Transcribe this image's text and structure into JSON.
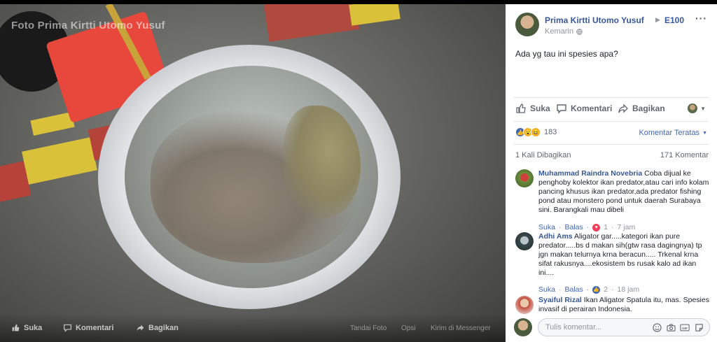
{
  "photo": {
    "watermark": "Foto Prima Kirtti Utomo Yusuf",
    "actions": {
      "like": "Suka",
      "comment": "Komentari",
      "share": "Bagikan",
      "tag_photo": "Tandai Foto",
      "options": "Opsi",
      "send_messenger": "Kirim di Messenger"
    }
  },
  "post": {
    "author": "Prima Kirtti Utomo Yusuf",
    "target": "E100",
    "time": "Kemarin",
    "text": "Ada yg tau ini spesies apa?",
    "actions": {
      "like": "Suka",
      "comment": "Komentari",
      "share": "Bagikan"
    },
    "reaction_count": "183",
    "sort_label": "Komentar Teratas",
    "share_count": "1 Kali Dibagikan",
    "comment_count": "171 Komentar"
  },
  "comments": [
    {
      "name": "Muhammad Raindra Novebria",
      "text": "Coba dijual ke penghoby kolektor ikan predator,atau cari info kolam pancing khusus ikan predator,ada predator fishing pond atau monstero pond untuk daerah Surabaya sini. Barangkali mau dibeli",
      "like": "Suka",
      "reply": "Balas",
      "reaction_count": "1",
      "time": "7 jam"
    },
    {
      "name": "Adhi Ams",
      "text": "Aligator gar.....kategori ikan pure predator.....bs d makan sih(gtw rasa dagingnya) tp jgn makan telurnya krna beracun..... Trkenal krna sifat rakusnya....ekosistem bs rusak kalo ad ikan ini....",
      "like": "Suka",
      "reply": "Balas",
      "reaction_count": "2",
      "time": "18 jam"
    },
    {
      "name": "Syaiful Rizal",
      "text": "Ikan Aligator Spatula itu, mas. Spesies invasif di perairan Indonesia."
    }
  ],
  "write_comment": {
    "placeholder": "Tulis komentar..."
  },
  "colors": {
    "link": "#365899",
    "accent": "#4267b2",
    "muted": "#90949c"
  }
}
